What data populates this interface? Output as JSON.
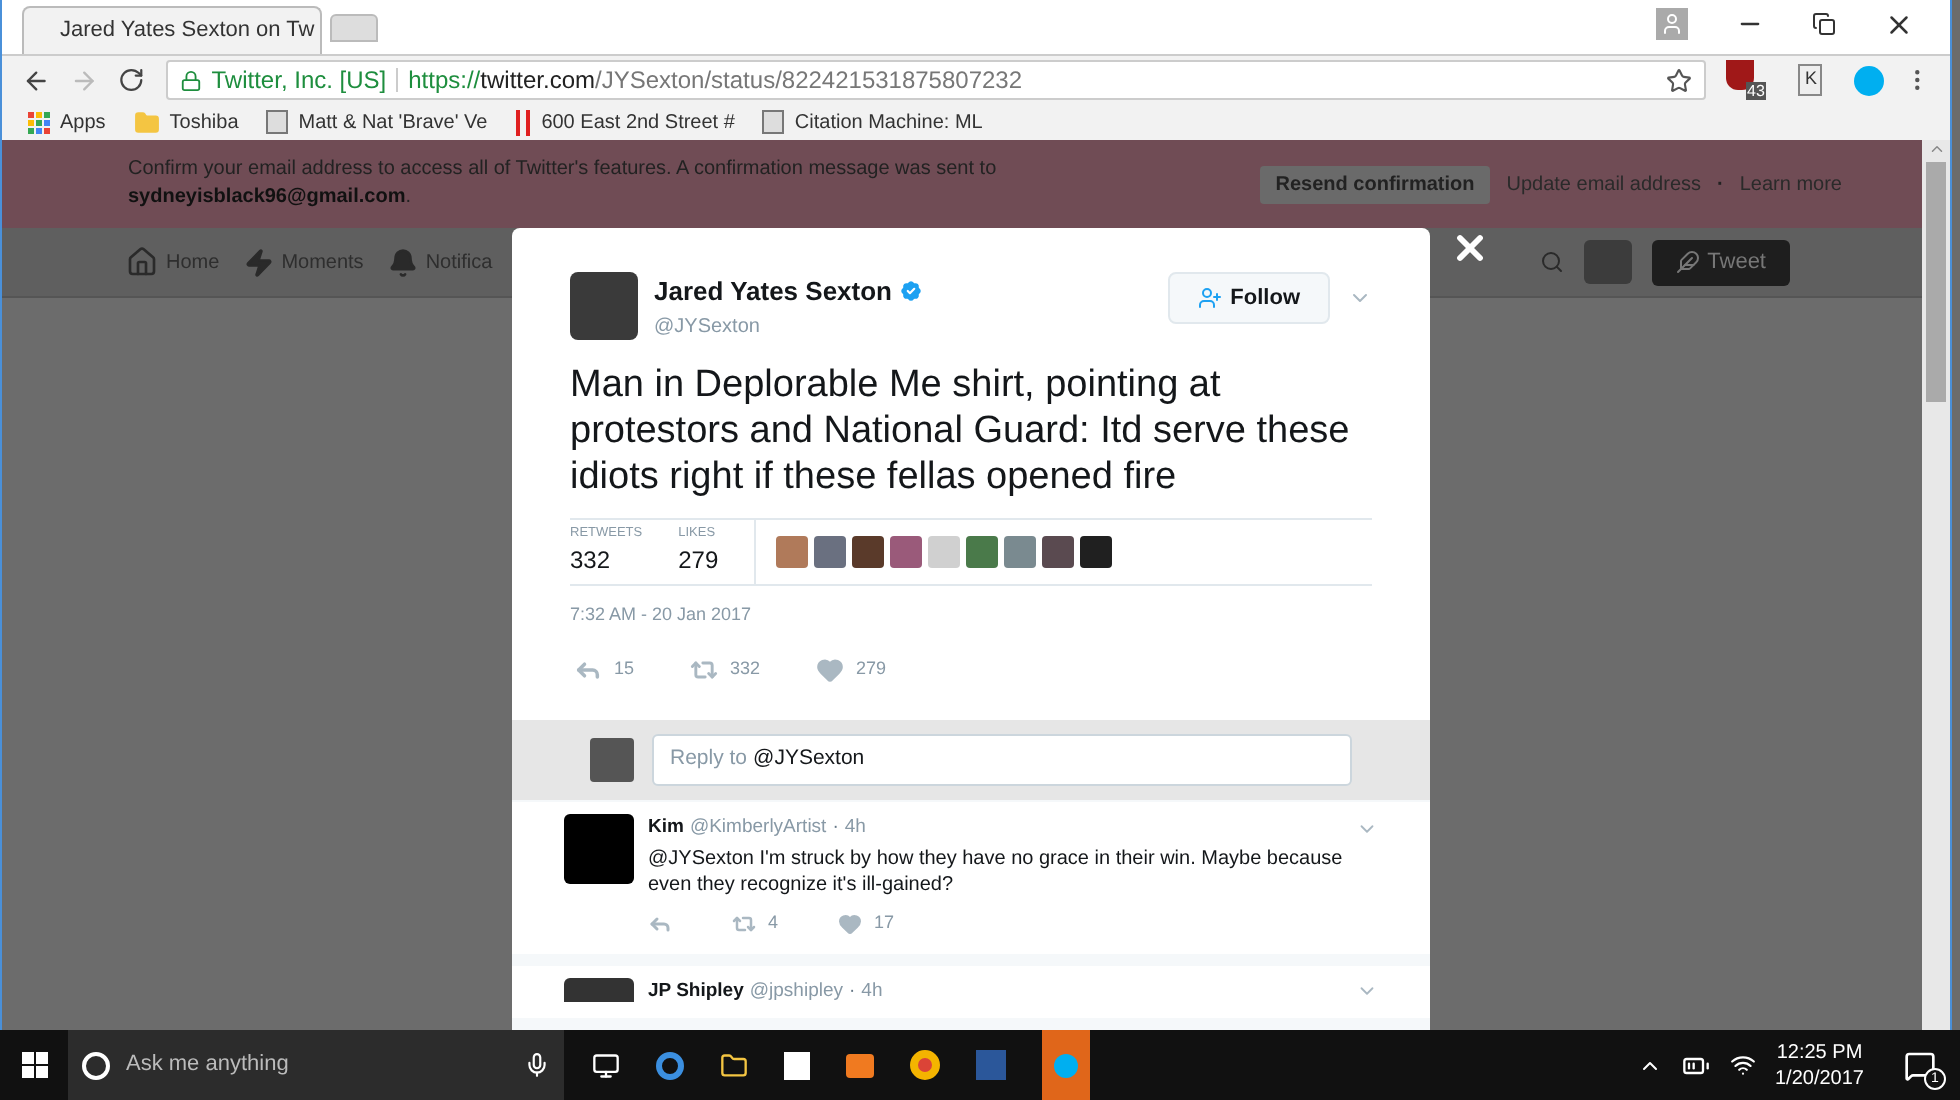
{
  "browser": {
    "tabs": [
      {
        "title": "Jared Yates Sexton on Tw",
        "selected": true
      },
      {
        "selected": false
      }
    ],
    "address": {
      "site_identity": "Twitter, Inc. [US]",
      "url_scheme": "https://",
      "url_host": "twitter.com",
      "url_path": "/JYSexton/status/822421531875807232"
    },
    "extension_badge": "43",
    "extension_letter": "K",
    "bookmarks": [
      {
        "kind": "apps",
        "label": "Apps"
      },
      {
        "kind": "folder",
        "label": "Toshiba"
      },
      {
        "kind": "page",
        "label": "Matt & Nat 'Brave' Ve"
      },
      {
        "kind": "bars",
        "label": "600 East 2nd Street #"
      },
      {
        "kind": "page",
        "label": "Citation Machine: ML"
      }
    ]
  },
  "banner": {
    "message": "Confirm your email address to access all of Twitter's features. A confirmation message was sent to",
    "email": "sydneyisblack96@gmail.com",
    "email_suffix": ".",
    "resend_button": "Resend confirmation",
    "link_separator": "·",
    "links": [
      "Update email address",
      "Learn more"
    ]
  },
  "nav": {
    "items": [
      {
        "kind": "home",
        "label": "Home"
      },
      {
        "kind": "moments",
        "label": "Moments"
      },
      {
        "kind": "notifications",
        "label": "Notifica"
      }
    ],
    "tweet_button": "Tweet"
  },
  "tweet": {
    "name": "Jared Yates Sexton",
    "verified": true,
    "handle": "@JYSexton",
    "follow_button": "Follow",
    "text": "Man in Deplorable Me shirt, pointing at protestors and National Guard: Itd serve these idiots right if these fellas opened fire",
    "stats": [
      {
        "label": "RETWEETS",
        "value": "332"
      },
      {
        "label": "LIKES",
        "value": "279"
      }
    ],
    "likers": [
      {
        "color": "#b07a5a"
      },
      {
        "color": "#6a7080"
      },
      {
        "color": "#5a3a2a"
      },
      {
        "color": "#9a5a7a"
      },
      {
        "color": "#d0d0d0"
      },
      {
        "color": "#4a7a4a"
      },
      {
        "color": "#7a8a90"
      },
      {
        "color": "#5a4a50"
      },
      {
        "color": "#202020"
      }
    ],
    "timestamp": "7:32 AM - 20 Jan 2017",
    "actions": [
      {
        "kind": "reply",
        "count": "15"
      },
      {
        "kind": "retweet",
        "count": "332"
      },
      {
        "kind": "like",
        "count": "279"
      }
    ]
  },
  "reply_box": {
    "placeholder": "Reply to",
    "mention": "@JYSexton"
  },
  "replies": [
    {
      "name": "Kim",
      "handle": "@KimberlyArtist",
      "separator": "·",
      "time": "4h",
      "text": "@JYSexton I'm struck by how they have no grace in their win. Maybe because even they recognize it's ill-gained?",
      "actions": [
        {
          "kind": "reply"
        },
        {
          "kind": "retweet",
          "count": "4"
        },
        {
          "kind": "like",
          "count": "17"
        }
      ]
    },
    {
      "name": "JP Shipley",
      "handle": "@jpshipley",
      "separator": "·",
      "time": "4h"
    }
  ],
  "taskbar": {
    "search_placeholder": "Ask me anything",
    "time": "12:25 PM",
    "date": "1/20/2017",
    "notification_count": "1"
  }
}
